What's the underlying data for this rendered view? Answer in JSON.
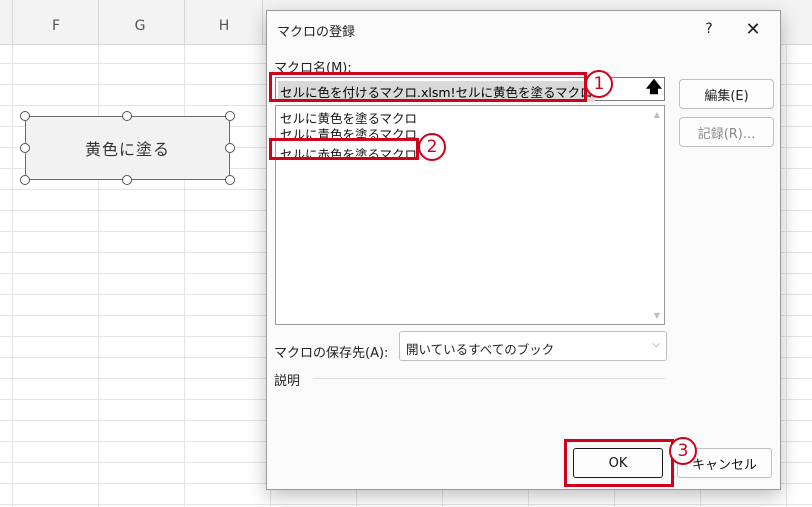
{
  "sheet": {
    "columns": [
      "F",
      "G",
      "H"
    ],
    "shape_label": "黄色に塗る"
  },
  "dialog": {
    "title": "マクロの登録",
    "help": "?",
    "close": "✕",
    "macro_name_label": "マクロ名(M):",
    "macro_name_value": "セルに色を付けるマクロ.xlsm!セルに黄色を塗るマクロ",
    "collapse_icon": "🡅",
    "macro_list": [
      "セルに黄色を塗るマクロ",
      "セルに青色を塗るマクロ",
      "セルに赤色を塗るマクロ"
    ],
    "edit_label": "編集(E)",
    "record_label": "記録(R)...",
    "store_label": "マクロの保存先(A):",
    "store_value": "開いているすべてのブック",
    "description_label": "説明",
    "ok_label": "OK",
    "cancel_label": "キャンセル"
  },
  "annotations": {
    "badge1": "1",
    "badge2": "2",
    "badge3": "3",
    "color": "#d0021b"
  }
}
